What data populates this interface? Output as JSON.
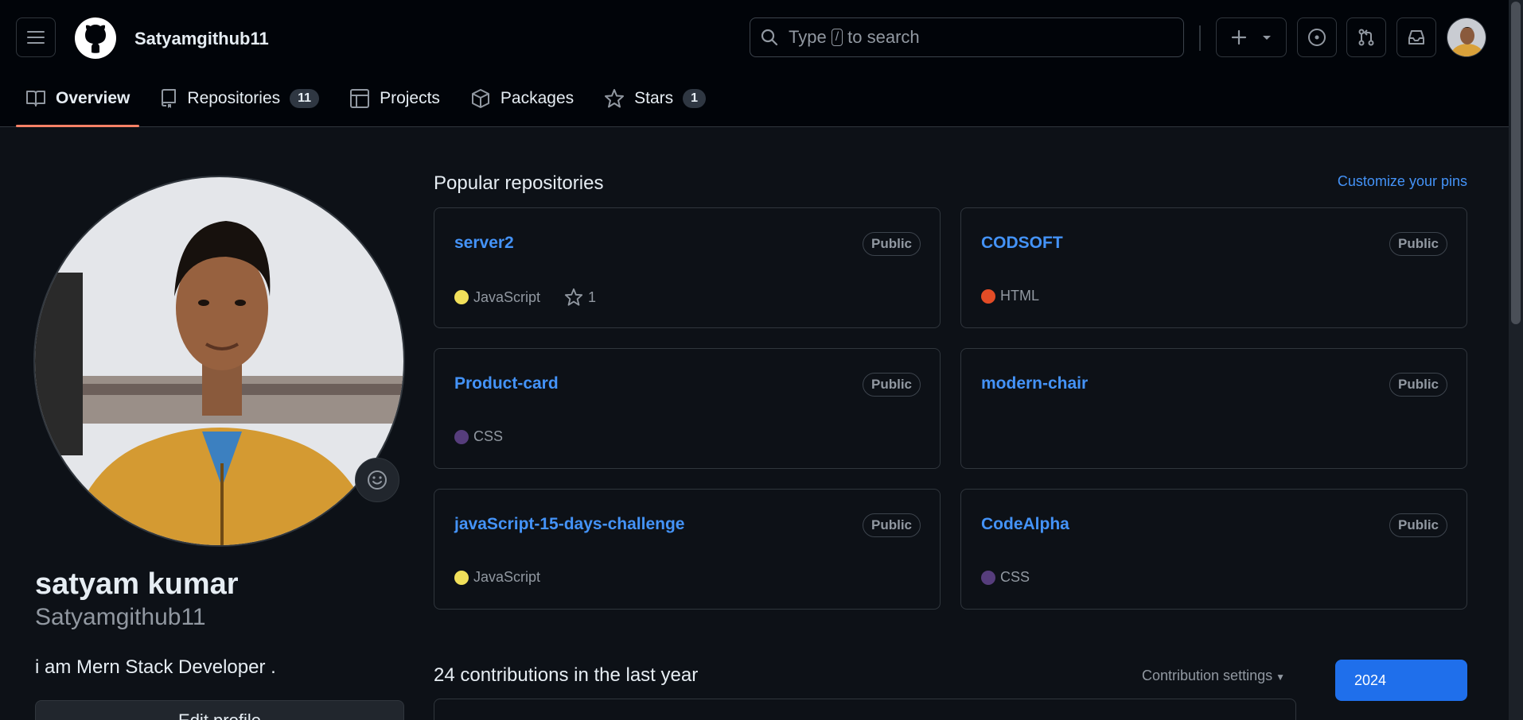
{
  "header": {
    "username": "Satyamgithub11",
    "search_placeholder_pre": "Type",
    "search_slash": "/",
    "search_placeholder_post": "to search"
  },
  "tabs": [
    {
      "label": "Overview",
      "icon": "book-icon",
      "active": true
    },
    {
      "label": "Repositories",
      "icon": "repo-icon",
      "count": "11"
    },
    {
      "label": "Projects",
      "icon": "table-icon"
    },
    {
      "label": "Packages",
      "icon": "package-icon"
    },
    {
      "label": "Stars",
      "icon": "star-icon",
      "count": "1"
    }
  ],
  "profile": {
    "full_name": "satyam kumar",
    "login": "Satyamgithub11",
    "bio": "i am Mern Stack Developer .",
    "edit_label": "Edit profile"
  },
  "popular": {
    "title": "Popular repositories",
    "customize_label": "Customize your pins",
    "repos": [
      {
        "name": "server2",
        "visibility": "Public",
        "language": "JavaScript",
        "lang_color": "#f1e05a",
        "stars": "1"
      },
      {
        "name": "CODSOFT",
        "visibility": "Public",
        "language": "HTML",
        "lang_color": "#e34c26"
      },
      {
        "name": "Product-card",
        "visibility": "Public",
        "language": "CSS",
        "lang_color": "#563d7c"
      },
      {
        "name": "modern-chair",
        "visibility": "Public"
      },
      {
        "name": "javaScript-15-days-challenge",
        "visibility": "Public",
        "language": "JavaScript",
        "lang_color": "#f1e05a"
      },
      {
        "name": "CodeAlpha",
        "visibility": "Public",
        "language": "CSS",
        "lang_color": "#563d7c"
      }
    ]
  },
  "contributions": {
    "title": "24 contributions in the last year",
    "settings_label": "Contribution settings",
    "year": "2024"
  },
  "colors": {
    "accent": "#4493f8",
    "tab_underline": "#f78166",
    "primary_button": "#1f6feb"
  }
}
